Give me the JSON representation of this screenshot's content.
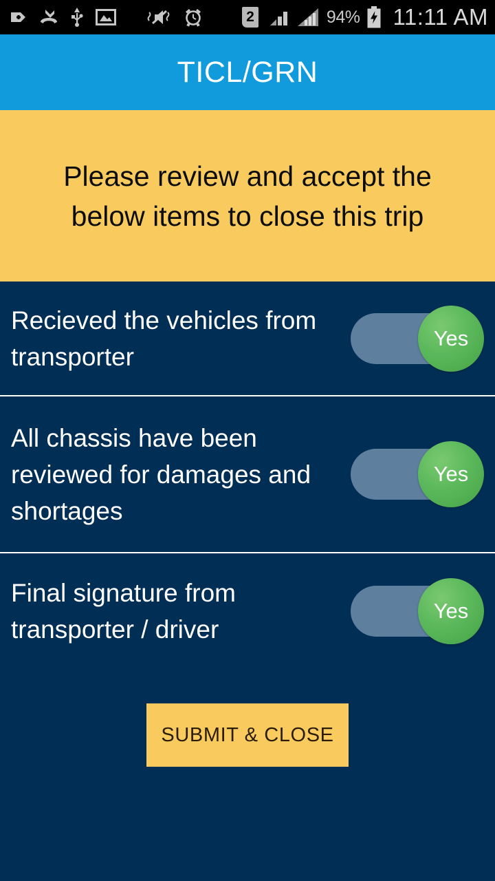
{
  "status_bar": {
    "icons": [
      {
        "name": "add-badge-icon",
        "glyph": "plus-tag"
      },
      {
        "name": "missed-call-icon",
        "glyph": "missed-call"
      },
      {
        "name": "usb-icon",
        "glyph": "usb"
      },
      {
        "name": "screenshot-image-icon",
        "glyph": "image"
      },
      {
        "name": "vibrate-mute-icon",
        "glyph": "mute-vibrate"
      },
      {
        "name": "alarm-clock-icon",
        "glyph": "alarm"
      }
    ],
    "sim_badge": "2",
    "signal_icons": [
      "signal-bars-sim1-icon",
      "signal-bars-sim2-icon"
    ],
    "battery_percent": "94%",
    "battery_icon": "battery-charging-icon",
    "clock": "11:11 AM"
  },
  "app_bar": {
    "title": "TICL/GRN"
  },
  "banner": {
    "line1": "Please review and accept the",
    "line2": "below items to close this trip"
  },
  "checklist": {
    "items": [
      {
        "label": "Recieved the vehicles from transporter",
        "toggle_state": "Yes",
        "toggle_on": true
      },
      {
        "label": "All chassis have been reviewed for damages and shortages",
        "toggle_state": "Yes",
        "toggle_on": true
      },
      {
        "label": "Final signature from transporter / driver",
        "toggle_state": "Yes",
        "toggle_on": true
      }
    ]
  },
  "submit": {
    "label": "SUBMIT & CLOSE"
  },
  "colors": {
    "status_bar_bg": "#000000",
    "app_bar_bg": "#119bdc",
    "banner_bg": "#f9cb5e",
    "page_bg": "#002e55",
    "toggle_track": "#5f7f9e",
    "toggle_knob": "#5cb85c",
    "submit_bg": "#f9cb5e",
    "divider": "#ffffff"
  }
}
